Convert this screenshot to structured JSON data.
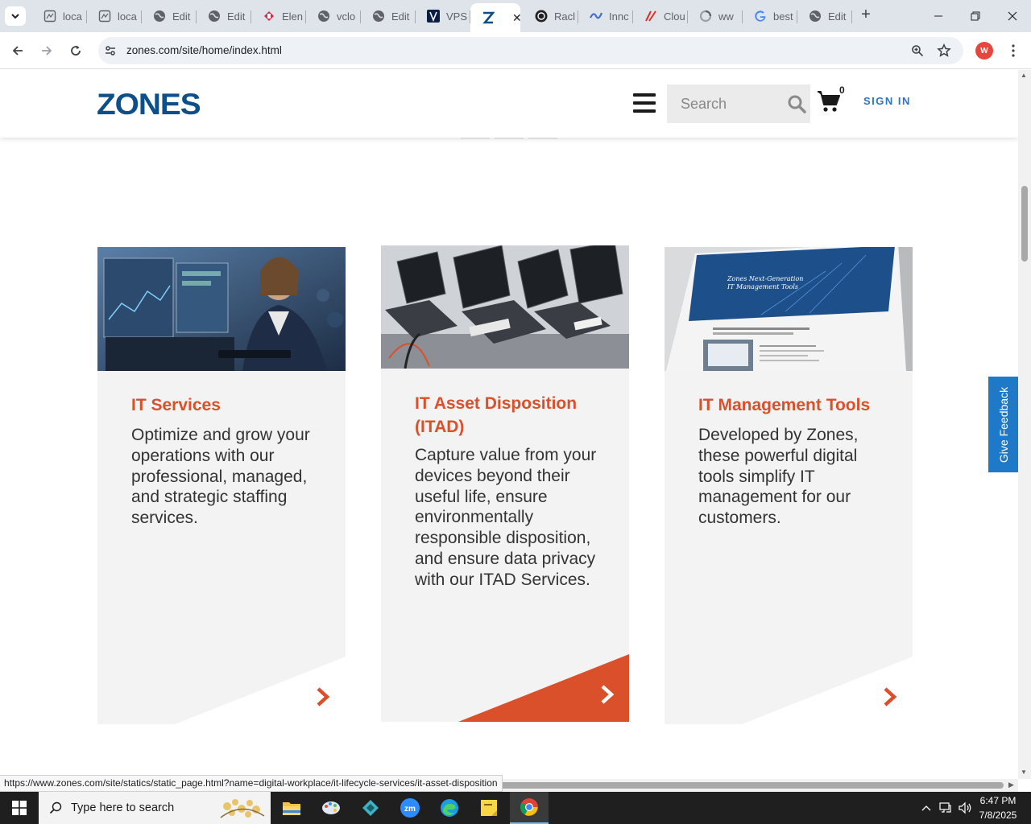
{
  "browser": {
    "tabs": [
      {
        "label": "loca",
        "icon": "document-icon"
      },
      {
        "label": "loca",
        "icon": "document-icon"
      },
      {
        "label": "Edit",
        "icon": "globe-icon"
      },
      {
        "label": "Edit",
        "icon": "globe-icon"
      },
      {
        "label": "Elen",
        "icon": "elementor-icon"
      },
      {
        "label": "vclo",
        "icon": "globe-icon"
      },
      {
        "label": "Edit",
        "icon": "globe-icon"
      },
      {
        "label": "VPS",
        "icon": "vps-icon"
      },
      {
        "label": "",
        "icon": "zones-icon",
        "active": true
      },
      {
        "label": "Racl",
        "icon": "openai-icon"
      },
      {
        "label": "Innc",
        "icon": "innovation-icon"
      },
      {
        "label": "Clou",
        "icon": "cloud-icon"
      },
      {
        "label": "ww",
        "icon": "loading-icon"
      },
      {
        "label": "best",
        "icon": "google-icon"
      },
      {
        "label": "Edit",
        "icon": "globe-icon"
      }
    ],
    "close_tab_glyph": "✕",
    "new_tab_glyph": "+",
    "url": "zones.com/site/home/index.html",
    "profile_initial": "W",
    "status_url": "https://www.zones.com/site/statics/static_page.html?name=digital-workplace/it-lifecycle-services/it-asset-disposition"
  },
  "site": {
    "logo": "ZONES",
    "search_placeholder": "Search",
    "cart_count": "0",
    "sign_in": "SIGN IN",
    "feedback": "Give Feedback",
    "cards": [
      {
        "title": "IT Services",
        "body": "Optimize and grow your operations with our professional, managed, and strategic staffing services.",
        "highlighted": false
      },
      {
        "title": "IT Asset Disposition (ITAD)",
        "body": "Capture value from your devices beyond their useful life, ensure environmentally responsible disposition, and ensure data privacy with our ITAD Services.",
        "highlighted": true
      },
      {
        "title": "IT Management Tools",
        "body": "Developed by Zones, these powerful digital tools simplify IT management for our customers.",
        "highlighted": false
      }
    ],
    "screen_mock": {
      "heading": "Zones Next-Generation IT Management Tools",
      "text": "Self-service tools that simplify procurement, tracking, and reporting, plus customer service when you need it.",
      "section": "Streamlined Procurement"
    }
  },
  "taskbar": {
    "search_placeholder": "Type here to search",
    "time": "6:47 PM",
    "date": "7/8/2025"
  },
  "colors": {
    "accent_orange": "#d9502a",
    "zones_blue": "#0d4f8b",
    "feedback_blue": "#1f79c9"
  }
}
